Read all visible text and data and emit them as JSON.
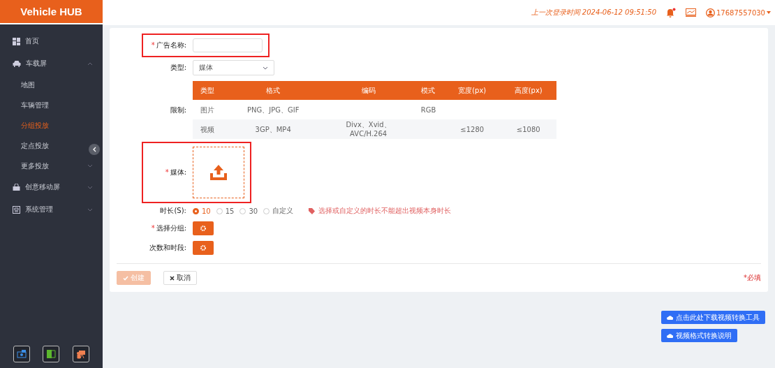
{
  "sidebar": {
    "logo": "Vehicle HUB",
    "items": [
      {
        "label": "首页"
      },
      {
        "label": "车载屏",
        "expanded": true,
        "children": [
          {
            "label": "地图",
            "selected": false
          },
          {
            "label": "车辆管理",
            "selected": false
          },
          {
            "label": "分组投放",
            "selected": true
          },
          {
            "label": "定点投放",
            "selected": false
          },
          {
            "label": "更多投放",
            "selected": false,
            "expandable": true
          }
        ]
      },
      {
        "label": "创意移动屏",
        "expanded": false
      },
      {
        "label": "系统管理",
        "expanded": false
      }
    ]
  },
  "topbar": {
    "last_login": "上一次登录时间 2024-06-12 09:51:50",
    "notification": true,
    "user": "17687557030"
  },
  "form": {
    "fields": [
      {
        "kind": "text",
        "label": "广告名称:",
        "required_mark": "*",
        "highlighted": true
      },
      {
        "kind": "select",
        "label": "类型:",
        "value": "媒体"
      },
      {
        "kind": "table",
        "label": "限制:",
        "columns": [
          "类型",
          "格式",
          "编码",
          "模式",
          "宽度(px)",
          "高度(px)"
        ],
        "rows": [
          [
            "图片",
            "PNG、JPG、GIF",
            null,
            "RGB",
            null,
            null
          ],
          [
            "视频",
            "3GP、MP4",
            "Divx、Xvid、\nAVC/H.264",
            null,
            "≤1280",
            "≤1080"
          ]
        ]
      },
      {
        "kind": "upload",
        "label": "媒体:",
        "required_mark": "*",
        "highlighted": true
      },
      {
        "kind": "radio",
        "label": "时长(S):",
        "options": [
          {
            "label": "10",
            "selected": true
          },
          {
            "label": "15",
            "selected": false
          },
          {
            "label": "30",
            "selected": false
          },
          {
            "label": "自定义",
            "selected": false
          }
        ],
        "hint": "选择或自定义的时长不能超出视频本身时长"
      },
      {
        "kind": "gear",
        "label": "选择分组:",
        "required_mark": "*"
      },
      {
        "kind": "gear",
        "label": "次数和时段:"
      }
    ],
    "create_button": {
      "label": "创建",
      "disabled": true
    },
    "cancel_button": {
      "label": "取消"
    },
    "required_note": "*必填"
  },
  "download_buttons": [
    "点击此处下载视频转换工具",
    "视频格式转换说明"
  ]
}
